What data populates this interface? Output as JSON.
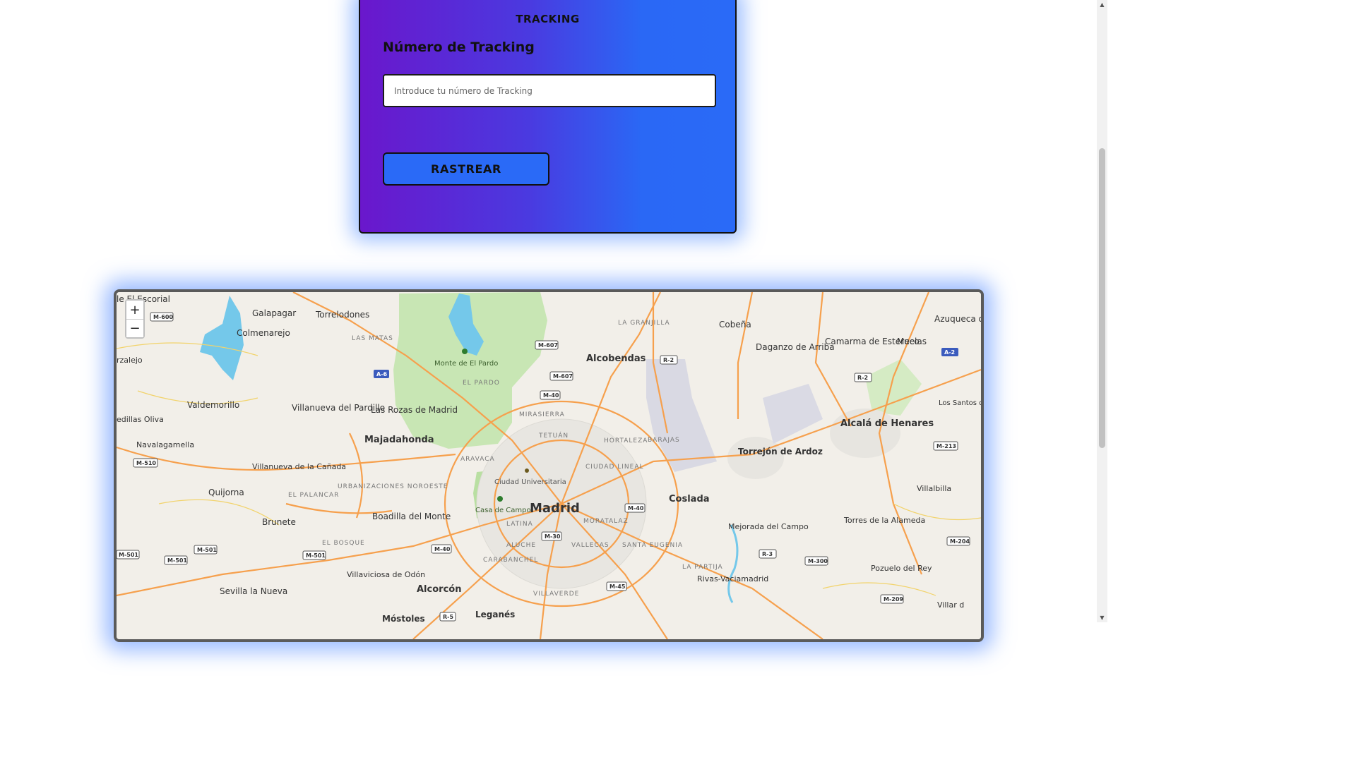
{
  "tracking": {
    "title": "TRACKING",
    "label": "Número de Tracking",
    "placeholder": "Introduce tu número de Tracking",
    "button": "RASTREAR"
  },
  "map": {
    "zoom_in": "+",
    "zoom_out": "−",
    "places": [
      {
        "name": "le El Escorial",
        "type": "town"
      },
      {
        "name": "Galapagar",
        "type": "town"
      },
      {
        "name": "Torrelodones",
        "type": "town"
      },
      {
        "name": "Colmenarejo",
        "type": "town"
      },
      {
        "name": "LA GRANJILLA",
        "type": "district"
      },
      {
        "name": "Cobeña",
        "type": "town"
      },
      {
        "name": "Azuqueca de Henares",
        "type": "town"
      },
      {
        "name": "LAS MATAS",
        "type": "district"
      },
      {
        "name": "Monte de El Pardo",
        "type": "park"
      },
      {
        "name": "Alcobendas",
        "type": "city"
      },
      {
        "name": "Daganzo de Arriba",
        "type": "town"
      },
      {
        "name": "Camarma de Esteruelas",
        "type": "town"
      },
      {
        "name": "Meco",
        "type": "town"
      },
      {
        "name": "rzalejo",
        "type": "town"
      },
      {
        "name": "EL PARDO",
        "type": "district"
      },
      {
        "name": "Valdemorillo",
        "type": "town"
      },
      {
        "name": "Villanueva del Pardillo",
        "type": "town"
      },
      {
        "name": "Las Rozas de Madrid",
        "type": "city"
      },
      {
        "name": "MIRASIERRA",
        "type": "district"
      },
      {
        "name": "edillas Oliva",
        "type": "town"
      },
      {
        "name": "Los Santos de la Humosa",
        "type": "town"
      },
      {
        "name": "Majadahonda",
        "type": "city"
      },
      {
        "name": "Alcalá de Henares",
        "type": "city"
      },
      {
        "name": "Navalagamella",
        "type": "town"
      },
      {
        "name": "HORTALEZA",
        "type": "district"
      },
      {
        "name": "BARAJAS",
        "type": "district"
      },
      {
        "name": "TETUÁN",
        "type": "district"
      },
      {
        "name": "Torrejón de Ardoz",
        "type": "city"
      },
      {
        "name": "ARAVACA",
        "type": "district"
      },
      {
        "name": "CIUDAD LINEAL",
        "type": "district"
      },
      {
        "name": "Villanueva de la Cañada",
        "type": "town"
      },
      {
        "name": "Ciudad Universitaria",
        "type": "park"
      },
      {
        "name": "URBANIZACIONES NOROESTE",
        "type": "district"
      },
      {
        "name": "Villalbilla",
        "type": "town"
      },
      {
        "name": "Quijorna",
        "type": "town"
      },
      {
        "name": "EL PALANCAR",
        "type": "district"
      },
      {
        "name": "Coslada",
        "type": "city"
      },
      {
        "name": "Madrid",
        "type": "capital"
      },
      {
        "name": "Casa de Campo",
        "type": "park"
      },
      {
        "name": "Boadilla del Monte",
        "type": "city"
      },
      {
        "name": "Brunete",
        "type": "town"
      },
      {
        "name": "LATINA",
        "type": "district"
      },
      {
        "name": "MORATALAZ",
        "type": "district"
      },
      {
        "name": "Mejorada del Campo",
        "type": "town"
      },
      {
        "name": "Torres de la Alameda",
        "type": "town"
      },
      {
        "name": "EL BOSQUE",
        "type": "district"
      },
      {
        "name": "ALUCHE",
        "type": "district"
      },
      {
        "name": "VALLECAS",
        "type": "district"
      },
      {
        "name": "SANTA EUGENIA",
        "type": "district"
      },
      {
        "name": "CARABANCHEL",
        "type": "district"
      },
      {
        "name": "LA PARTIJA",
        "type": "district"
      },
      {
        "name": "Pozuelo del Rey",
        "type": "town"
      },
      {
        "name": "Villaviciosa de Odón",
        "type": "town"
      },
      {
        "name": "Rivas-Vaciamadrid",
        "type": "city"
      },
      {
        "name": "Sevilla la Nueva",
        "type": "town"
      },
      {
        "name": "Alcorcón",
        "type": "city"
      },
      {
        "name": "VILLAVERDE",
        "type": "district"
      },
      {
        "name": "Villar d",
        "type": "town"
      },
      {
        "name": "Móstoles",
        "type": "city"
      },
      {
        "name": "Leganés",
        "type": "city"
      }
    ],
    "road_shields": [
      "M-600",
      "M-607",
      "R-2",
      "A-2",
      "A-6",
      "M-607",
      "M-40",
      "R-2",
      "M-510",
      "M-213",
      "M-40",
      "M-501",
      "M-501",
      "M-501",
      "M-501",
      "M-40",
      "M-30",
      "R-3",
      "M-204",
      "M-300",
      "M-45",
      "M-209",
      "R-5"
    ],
    "colors": {
      "land": "#f2efe9",
      "park": "#c8e6b4",
      "water": "#74c8ea",
      "road": "#f6a04d",
      "airport": "#d9d9e3"
    }
  }
}
